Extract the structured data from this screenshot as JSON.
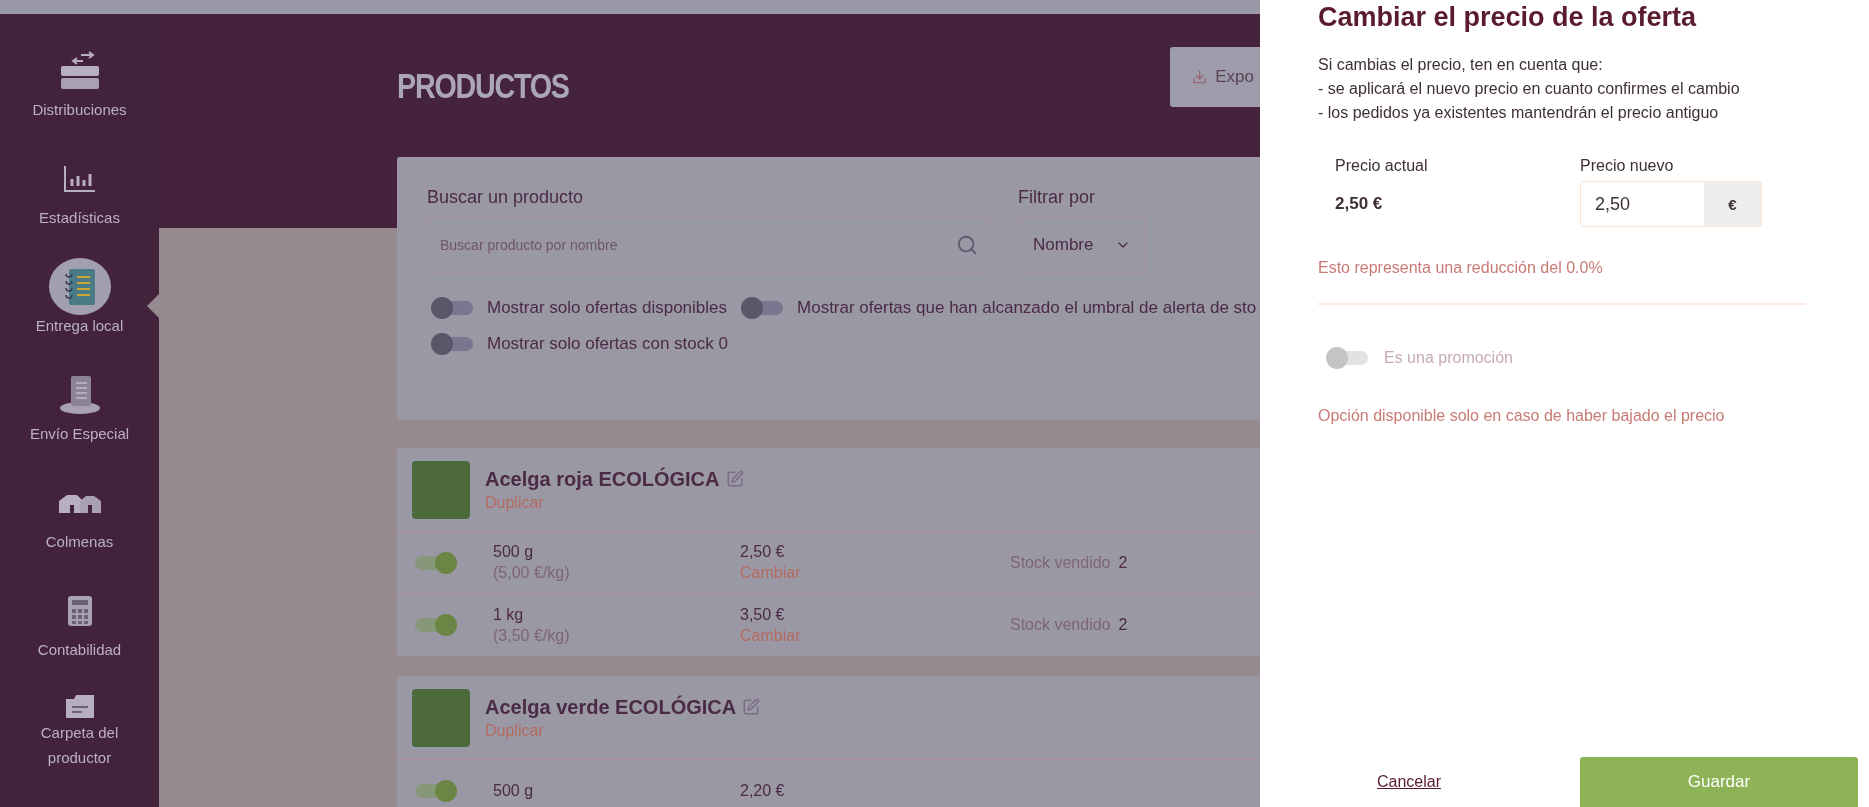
{
  "sidebar": {
    "items": [
      {
        "label": "Distribuciones",
        "selected": false
      },
      {
        "label": "Estadísticas",
        "selected": false
      },
      {
        "label": "Entrega local",
        "selected": true
      },
      {
        "label": "Envío Especial",
        "selected": false
      },
      {
        "label": "Colmenas",
        "selected": false
      },
      {
        "label": "Contabilidad",
        "selected": false
      },
      {
        "label": "Carpeta del productor",
        "selected": false
      }
    ]
  },
  "page_title": "PRODUCTOS",
  "export_button": "Expo",
  "filters": {
    "search_label": "Buscar un producto",
    "search_placeholder": "Buscar producto por nombre",
    "filter_label": "Filtrar por",
    "filter_value": "Nombre",
    "toggles": [
      {
        "label": "Mostrar solo ofertas disponibles",
        "on": false
      },
      {
        "label": "Mostrar ofertas que han alcanzado el umbral de alerta de sto",
        "on": false
      },
      {
        "label": "Mostrar solo ofertas con stock 0",
        "on": false
      }
    ]
  },
  "products": [
    {
      "name": "Acelga roja ECOLÓGICA",
      "action": "Duplicar",
      "offers": [
        {
          "on": true,
          "weight": "500 g",
          "unit_price": "(5,00 €/kg)",
          "price": "2,50 €",
          "change": "Cambiar",
          "stock_label": "Stock vendido",
          "stock": "2"
        },
        {
          "on": true,
          "weight": "1 kg",
          "unit_price": "(3,50 €/kg)",
          "price": "3,50 €",
          "change": "Cambiar",
          "stock_label": "Stock vendido",
          "stock": "2"
        }
      ]
    },
    {
      "name": "Acelga verde ECOLÓGICA",
      "action": "Duplicar",
      "offers": [
        {
          "on": true,
          "weight": "500 g",
          "price": "2,20 €"
        }
      ]
    }
  ],
  "panel": {
    "title": "Cambiar el precio de la oferta",
    "intro": [
      "Si cambias el precio, ten en cuenta que:",
      "- se aplicará el nuevo precio en cuanto confirmes el cambio",
      "- los pedidos ya existentes mantendrán el precio antiguo"
    ],
    "current_label": "Precio actual",
    "current_value": "2,50 €",
    "new_label": "Precio nuevo",
    "new_value": "2,50",
    "currency": "€",
    "reduction": "Esto representa una reducción del 0.0%",
    "promo": {
      "label": "Es una promoción",
      "on": false,
      "disabled": true
    },
    "promo_note": "Opción disponible solo en caso de haber bajado el precio",
    "cancel": "Cancelar",
    "save": "Guardar"
  }
}
